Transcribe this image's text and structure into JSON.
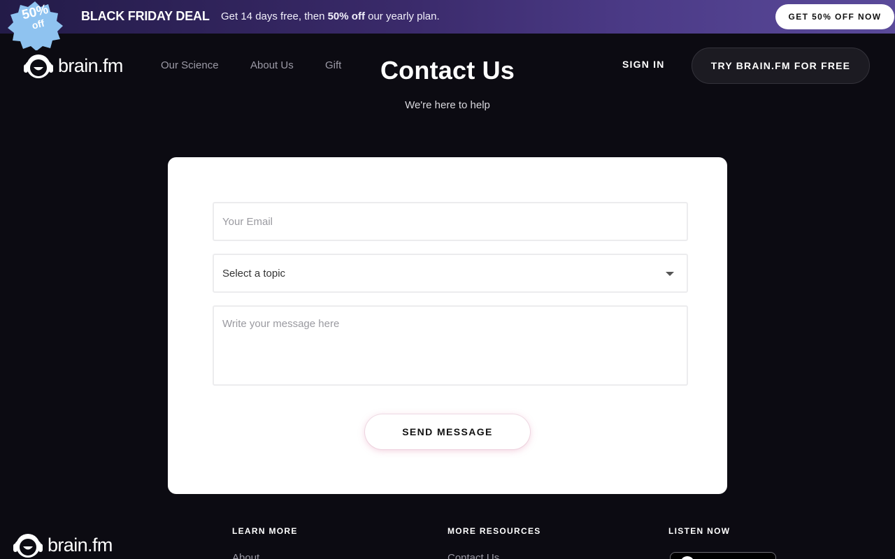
{
  "promo": {
    "badge_percent": "50%",
    "badge_off": "off",
    "title": "BLACK FRIDAY DEAL",
    "text_before": "Get 14 days free, then ",
    "text_bold": "50% off",
    "text_after": " our yearly plan.",
    "cta": "GET 50% OFF NOW",
    "colors": {
      "banner_start": "#231b48",
      "banner_end": "#5a4a9a",
      "badge": "#8fc3f0"
    }
  },
  "nav": {
    "logo_text": "brain.fm",
    "links": [
      "Our Science",
      "About Us",
      "Gift"
    ],
    "sign_in": "SIGN IN",
    "try_cta": "TRY BRAIN.FM FOR FREE"
  },
  "header": {
    "title": "Contact Us",
    "subtitle": "We're here to help"
  },
  "form": {
    "email_placeholder": "Your Email",
    "topic_selected": "Select a topic",
    "message_placeholder": "Write your message here",
    "send_label": "SEND MESSAGE"
  },
  "footer": {
    "logo_text": "brain.fm",
    "columns": [
      {
        "heading": "LEARN MORE",
        "first_link": "About"
      },
      {
        "heading": "MORE RESOURCES",
        "first_link": "Contact Us"
      },
      {
        "heading": "LISTEN NOW",
        "first_link": ""
      }
    ]
  },
  "colors": {
    "page_bg": "#0c0b12",
    "card_bg": "#ffffff",
    "muted_link": "#9c9aa6"
  }
}
